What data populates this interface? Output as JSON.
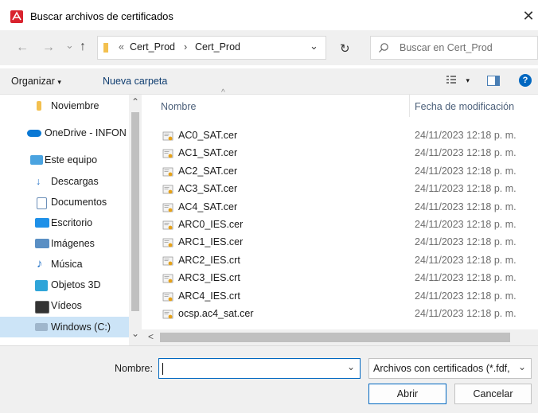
{
  "window": {
    "title": "Buscar archivos de certificados",
    "close_glyph": "✕"
  },
  "nav": {
    "back_glyph": "←",
    "forward_glyph": "→",
    "recent_glyph": "⌄",
    "up_glyph": "↑",
    "path_prefix": "«",
    "breadcrumb": [
      "Cert_Prod",
      "Cert_Prod"
    ],
    "separator": "›",
    "dropdown_glyph": "⌄",
    "refresh_glyph": "↻",
    "search_placeholder": "Buscar en Cert_Prod"
  },
  "toolbar": {
    "organize_label": "Organizar",
    "organize_arrow": "▾",
    "new_folder_label": "Nueva carpeta",
    "view_arrow": "▾",
    "help_glyph": "?"
  },
  "sidebar": {
    "items": [
      {
        "label": "Noviembre",
        "icon": "folder-icon"
      },
      {
        "label": "OneDrive - INFON",
        "icon": "cloud-icon"
      },
      {
        "label": "Este equipo",
        "icon": "computer-icon"
      },
      {
        "label": "Descargas",
        "icon": "download-icon"
      },
      {
        "label": "Documentos",
        "icon": "document-icon"
      },
      {
        "label": "Escritorio",
        "icon": "desktop-icon"
      },
      {
        "label": "Imágenes",
        "icon": "pictures-icon"
      },
      {
        "label": "Música",
        "icon": "music-icon"
      },
      {
        "label": "Objetos 3D",
        "icon": "3d-objects-icon"
      },
      {
        "label": "Vídeos",
        "icon": "videos-icon"
      },
      {
        "label": "Windows (C:)",
        "icon": "drive-icon"
      }
    ],
    "scroll_up_glyph": "⌃",
    "scroll_down_glyph": "⌄"
  },
  "file_list": {
    "columns": {
      "name": "Nombre",
      "modified": "Fecha de modificación"
    },
    "sort_glyph": "^",
    "files": [
      {
        "name": "AC0_SAT.cer",
        "modified": "24/11/2023 12:18 p. m."
      },
      {
        "name": "AC1_SAT.cer",
        "modified": "24/11/2023 12:18 p. m."
      },
      {
        "name": "AC2_SAT.cer",
        "modified": "24/11/2023 12:18 p. m."
      },
      {
        "name": "AC3_SAT.cer",
        "modified": "24/11/2023 12:18 p. m."
      },
      {
        "name": "AC4_SAT.cer",
        "modified": "24/11/2023 12:18 p. m."
      },
      {
        "name": "ARC0_IES.cer",
        "modified": "24/11/2023 12:18 p. m."
      },
      {
        "name": "ARC1_IES.cer",
        "modified": "24/11/2023 12:18 p. m."
      },
      {
        "name": "ARC2_IES.crt",
        "modified": "24/11/2023 12:18 p. m."
      },
      {
        "name": "ARC3_IES.crt",
        "modified": "24/11/2023 12:18 p. m."
      },
      {
        "name": "ARC4_IES.crt",
        "modified": "24/11/2023 12:18 p. m."
      },
      {
        "name": "ocsp.ac4_sat.cer",
        "modified": "24/11/2023 12:18 p. m."
      }
    ],
    "hscroll_left_glyph": "<"
  },
  "bottom": {
    "filename_label": "Nombre:",
    "filename_value": "",
    "filename_dropdown_glyph": "⌄",
    "filter_value": "Archivos con certificados (*.fdf,",
    "filter_dropdown_glyph": "⌄",
    "open_label": "Abrir",
    "cancel_label": "Cancelar"
  },
  "colors": {
    "accent": "#0067c0",
    "adobe_red": "#d9232e",
    "folder": "#f3c04f",
    "selected_bg": "#cce4f7"
  }
}
